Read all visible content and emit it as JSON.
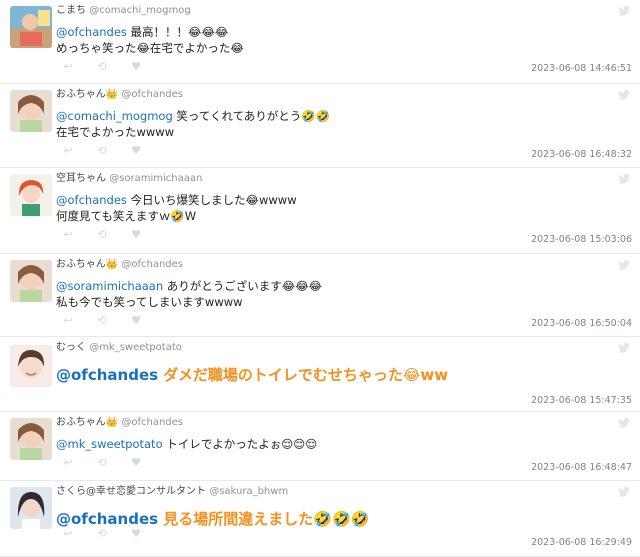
{
  "tweets": [
    {
      "name": "こまち",
      "handle": "@comachi_mogmog",
      "mention": "@ofchandes",
      "line1": " 最高！！！😂😂😂",
      "line2": "めっちゃ笑った😂在宅でよかった😂",
      "timestamp": "2023-06-08 14:46:51",
      "big": false
    },
    {
      "name": "おふちゃん👑",
      "handle": "@ofchandes",
      "mention": "@comachi_mogmog",
      "line1": " 笑ってくれてありがとう🤣🤣",
      "line2": "在宅でよかったwwww",
      "timestamp": "2023-06-08 16:48:32",
      "big": false
    },
    {
      "name": "空耳ちゃん",
      "handle": "@soramimichaaan",
      "mention": "@ofchandes",
      "line1": " 今日いち爆笑しました😂wwww",
      "line2": "何度見ても笑えますｗ🤣W",
      "timestamp": "2023-06-08 15:03:06",
      "big": false
    },
    {
      "name": "おふちゃん👑",
      "handle": "@ofchandes",
      "mention": "@soramimichaaan",
      "line1": " ありがとうございます😂😂😂",
      "line2": "私も今でも笑ってしまいますwwww",
      "timestamp": "2023-06-08 16:50:04",
      "big": false
    },
    {
      "name": "むっく",
      "handle": "@mk_sweetpotato",
      "mention": "@ofchandes",
      "line1": " ダメだ職場のトイレでむせちゃった😂ww",
      "line2": "",
      "timestamp": "2023-06-08 15:47:35",
      "big": true
    },
    {
      "name": "おふちゃん👑",
      "handle": "@ofchandes",
      "mention": "@mk_sweetpotato",
      "line1": " トイレでよかったよぉ😌😌😌",
      "line2": "",
      "timestamp": "2023-06-08 16:48:47",
      "big": false
    },
    {
      "name": "さくら@幸せ恋愛コンサルタント",
      "handle": "@sakura_bhwm",
      "mention": "@ofchandes",
      "line1": " 見る場所間違えました🤣🤣🤣",
      "line2": "",
      "timestamp": "2023-06-08 16:29:49",
      "big": true
    }
  ],
  "icons": {
    "reply": "reply-icon",
    "retweet": "retweet-icon",
    "like": "heart-icon",
    "brand": "twitter-bird-icon"
  },
  "colors": {
    "mention": "#1b6fbf",
    "highlight": "#f5901e",
    "action_icons": "#d4d9dd",
    "divider": "#e6e9ec"
  }
}
